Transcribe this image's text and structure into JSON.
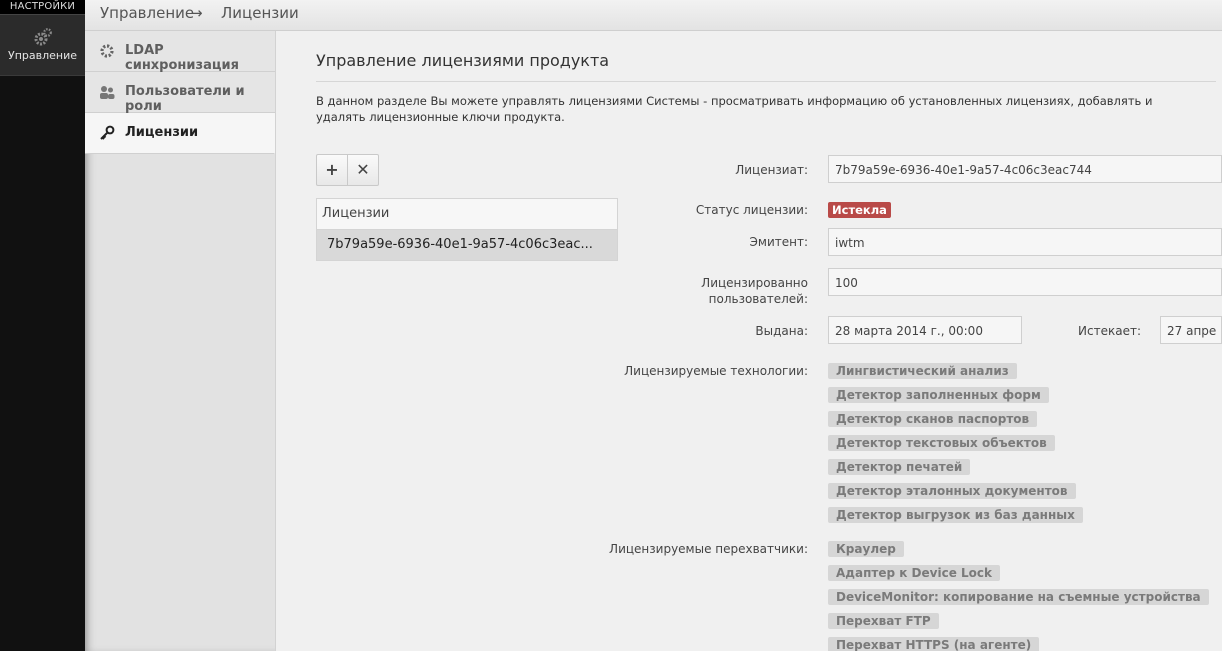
{
  "rail": {
    "title": "НАСТРОЙКИ",
    "item_label": "Управление"
  },
  "breadcrumb": {
    "root": "Управление",
    "arrow": "→",
    "current": "Лицензии"
  },
  "subnav": [
    {
      "label": "LDAP синхронизация",
      "icon": "gear-icon"
    },
    {
      "label": "Пользователи и роли",
      "icon": "users-icon"
    },
    {
      "label": "Лицензии",
      "icon": "key-icon"
    }
  ],
  "page": {
    "title": "Управление лицензиями продукта",
    "description": "В данном разделе Вы можете управлять лицензиями Системы - просматривать информацию об установленных лицензиях, добавлять и удалять лицензионные ключи продукта."
  },
  "toolbar": {
    "add": "+",
    "remove": "✕"
  },
  "licenses": {
    "header": "Лицензии",
    "rows": [
      "7b79a59e-6936-40e1-9a57-4c06c3eac..."
    ]
  },
  "details": {
    "licensee_label": "Лицензиат:",
    "licensee": "7b79a59e-6936-40e1-9a57-4c06c3eac744",
    "status_label": "Статус лицензии:",
    "status": "Истекла",
    "status_color": "#b94a48",
    "issuer_label": "Эмитент:",
    "issuer": "iwtm",
    "users_label_1": "Лицензированно",
    "users_label_2": "пользователей:",
    "users": "100",
    "issued_label": "Выдана:",
    "issued": "28 марта 2014 г., 00:00",
    "expires_label": "Истекает:",
    "expires": "27 апре",
    "tech_label": "Лицензируемые технологии:",
    "technologies": [
      "Лингвистический анализ",
      "Детектор заполненных форм",
      "Детектор сканов паспортов",
      "Детектор текстовых объектов",
      "Детектор печатей",
      "Детектор эталонных документов",
      "Детектор выгрузок из баз данных"
    ],
    "interceptors_label": "Лицензируемые перехватчики:",
    "interceptors": [
      "Краулер",
      "Адаптер к Device Lock",
      "DeviceMonitor: копирование на съемные устройства",
      "Перехват FTP",
      "Перехват HTTPS (на агенте)"
    ]
  }
}
